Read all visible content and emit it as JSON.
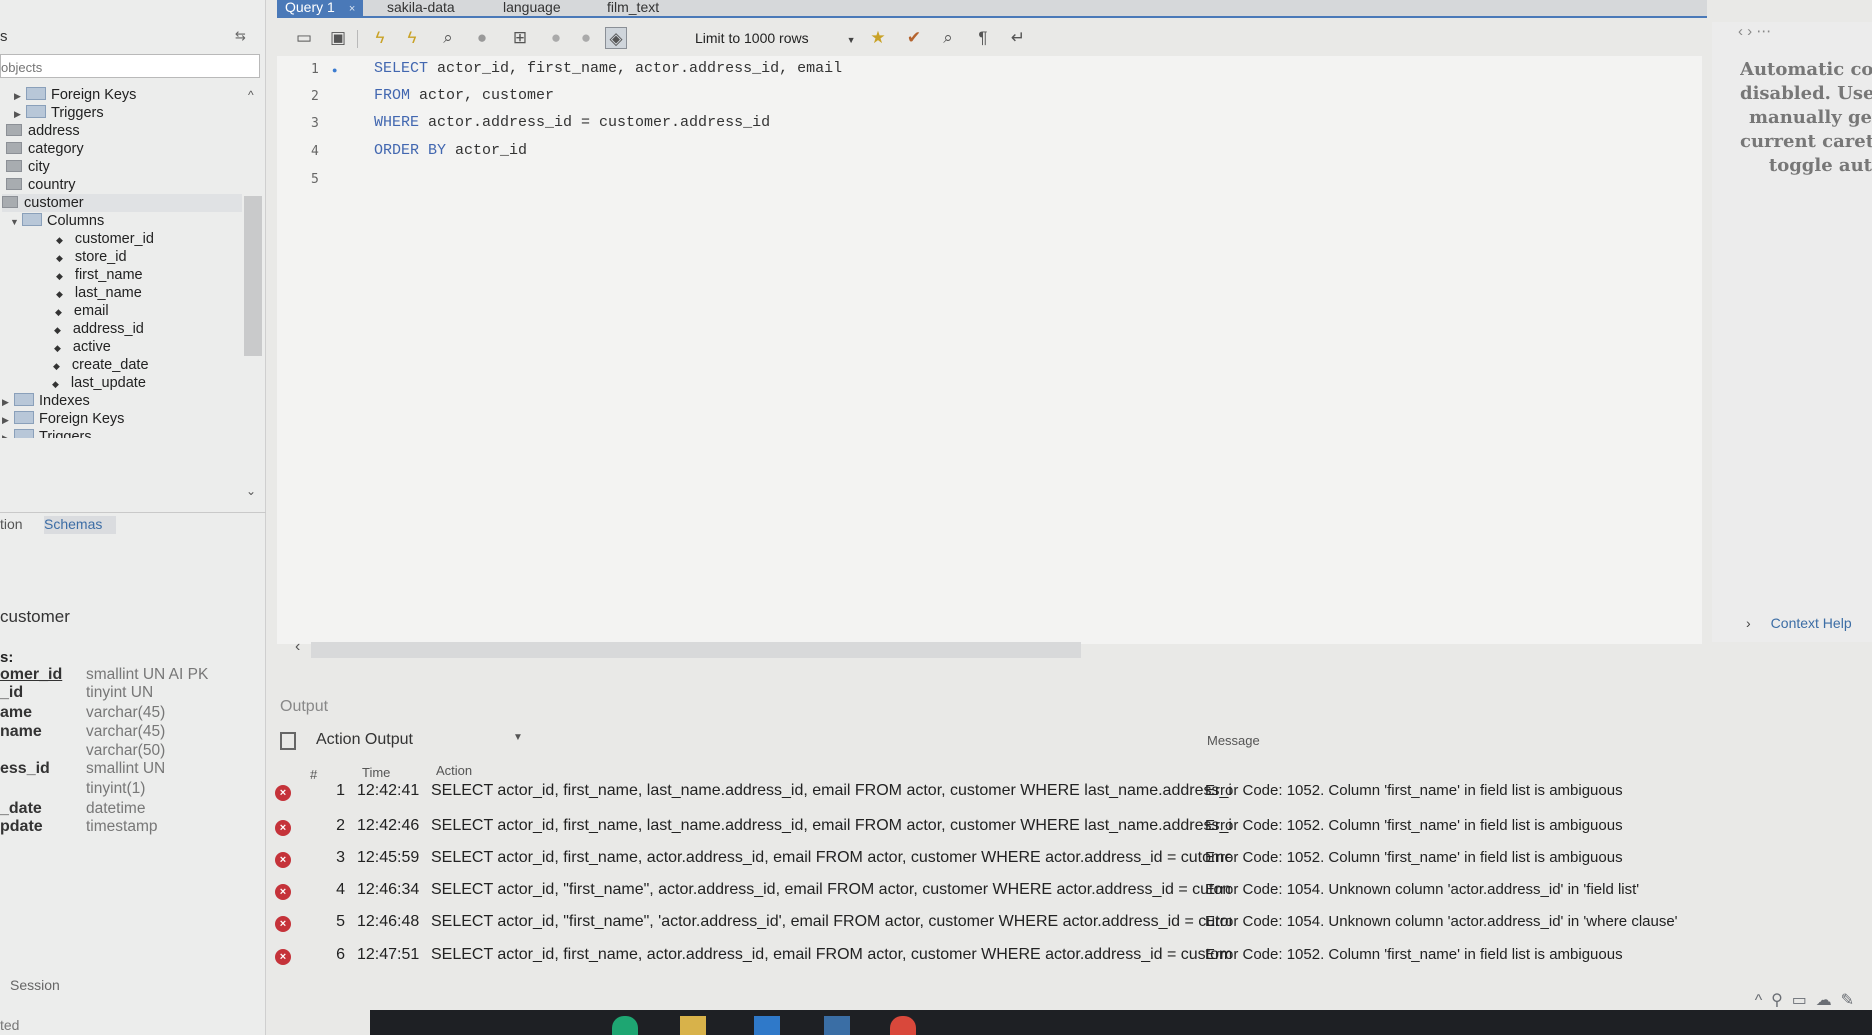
{
  "tabs": [
    {
      "label": "Query 1",
      "active": true
    },
    {
      "label": "sakila-data"
    },
    {
      "label": "language"
    },
    {
      "label": "film_text"
    }
  ],
  "tab_close": "×",
  "sidebar": {
    "title": "s",
    "filter_placeholder": "objects",
    "tree": [
      {
        "label": "Foreign Keys",
        "kind": "folder"
      },
      {
        "label": "Triggers",
        "kind": "folder"
      },
      {
        "label": "address",
        "kind": "table"
      },
      {
        "label": "category",
        "kind": "table"
      },
      {
        "label": "city",
        "kind": "table"
      },
      {
        "label": "country",
        "kind": "table"
      },
      {
        "label": "customer",
        "kind": "table"
      },
      {
        "label": "Columns",
        "kind": "folder-open"
      },
      {
        "label": "customer_id",
        "kind": "column"
      },
      {
        "label": "store_id",
        "kind": "column"
      },
      {
        "label": "first_name",
        "kind": "column"
      },
      {
        "label": "last_name",
        "kind": "column"
      },
      {
        "label": "email",
        "kind": "column"
      },
      {
        "label": "address_id",
        "kind": "column"
      },
      {
        "label": "active",
        "kind": "column"
      },
      {
        "label": "create_date",
        "kind": "column"
      },
      {
        "label": "last_update",
        "kind": "column"
      },
      {
        "label": "Indexes",
        "kind": "folder"
      },
      {
        "label": "Foreign Keys",
        "kind": "folder"
      },
      {
        "label": "Triggers",
        "kind": "folder"
      }
    ],
    "bottom_tabs": [
      "tion",
      "Schemas"
    ],
    "info": {
      "title": "customer",
      "columns_label": "s:",
      "columns": [
        {
          "name": "omer_id",
          "type": "smallint UN AI PK"
        },
        {
          "name": "_id",
          "type": "tinyint UN"
        },
        {
          "name": "ame",
          "type": "varchar(45)"
        },
        {
          "name": "name",
          "type": "varchar(45)"
        },
        {
          "name": "",
          "type": "varchar(50)"
        },
        {
          "name": "ess_id",
          "type": "smallint UN"
        },
        {
          "name": "",
          "type": "tinyint(1)"
        },
        {
          "name": "_date",
          "type": "datetime"
        },
        {
          "name": "pdate",
          "type": "timestamp"
        }
      ]
    },
    "session_label": "Session",
    "status_label": "ted"
  },
  "toolbar": {
    "limit_label": "Limit to 1000 rows"
  },
  "editor": {
    "lines": [
      {
        "num": "1",
        "kw": "SELECT",
        "text": " actor_id, first_name, actor.address_id, email"
      },
      {
        "num": "2",
        "kw": "FROM",
        "text": " actor, customer"
      },
      {
        "num": "3",
        "kw": "WHERE",
        "text": " actor.address_id = customer.address_id"
      },
      {
        "num": "4",
        "kw": "ORDER BY",
        "text": " actor_id"
      },
      {
        "num": "5",
        "kw": "",
        "text": ""
      }
    ]
  },
  "help": {
    "lines": [
      "Automatic co",
      "disabled. Use",
      "manually ge",
      "current caret",
      "toggle aut"
    ],
    "tab_label": "Context Help"
  },
  "output": {
    "label": "Output",
    "selector": "Action Output",
    "headers": {
      "num": "#",
      "time": "Time",
      "action": "Action",
      "message": "Message"
    },
    "rows": [
      {
        "num": "1",
        "time": "12:42:41",
        "action": "SELECT actor_id, first_name, last_name.address_id, email FROM actor, customer WHERE last_name.address_id = ...",
        "message": "Error Code: 1052. Column 'first_name' in field list is ambiguous"
      },
      {
        "num": "2",
        "time": "12:42:46",
        "action": "SELECT actor_id, first_name, last_name.address_id, email FROM actor, customer WHERE last_name.address_id = ...",
        "message": "Error Code: 1052. Column 'first_name' in field list is ambiguous"
      },
      {
        "num": "3",
        "time": "12:45:59",
        "action": "SELECT actor_id, first_name, actor.address_id, email FROM actor, customer WHERE actor.address_id = cutomer.a...",
        "message": "Error Code: 1052. Column 'first_name' in field list is ambiguous"
      },
      {
        "num": "4",
        "time": "12:46:34",
        "action": "SELECT actor_id, \"first_name\", actor.address_id, email FROM actor, customer WHERE actor.address_id = cutome...",
        "message": "Error Code: 1054. Unknown column 'actor.address_id' in 'field list'"
      },
      {
        "num": "5",
        "time": "12:46:48",
        "action": "SELECT actor_id, \"first_name\", 'actor.address_id', email FROM actor, customer WHERE actor.address_id = cutom...",
        "message": "Error Code: 1054. Unknown column 'actor.address_id' in 'where clause'"
      },
      {
        "num": "6",
        "time": "12:47:51",
        "action": "SELECT actor_id, first_name, actor.address_id, email FROM actor, customer WHERE actor.address_id = customer....",
        "message": "Error Code: 1052. Column 'first_name' in field list is ambiguous"
      }
    ]
  },
  "icons": {
    "error": "error-circle-icon",
    "colors": {
      "error": "#c5333a",
      "keyword": "#4267b0",
      "tab_active": "#4a79b8"
    }
  }
}
